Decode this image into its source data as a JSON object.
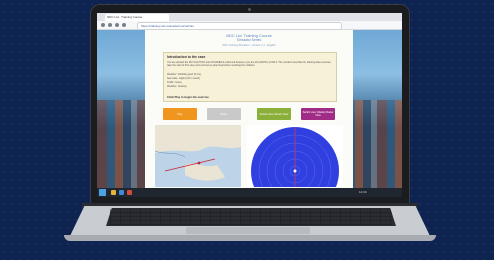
{
  "browser": {
    "tab_title": "NDC Ltd - Training Course",
    "url": "https://training.ndc.example/course/intro"
  },
  "page": {
    "title": "NDC Ltd. Training Course",
    "subtitle": "Simulator Series",
    "note": "NDC Training Simulator - Version 2.1 - English",
    "intro": {
      "heading": "Introduction to the case",
      "text": "You are aboard the MV CALYPSO and CHANNELS outbound between you are DA (DCPC) at 0013. The incident described in training data exercise; take the start of this case and commence planning before reaching the collision.",
      "lines": [
        "Weather: Visibility good (5 nm)",
        "Sea state: slight (2/3 m swell)",
        "Traffic: heavy",
        "Weather: clearing"
      ],
      "bold_line": "Click Play to begin the exercise"
    },
    "buttons": {
      "play": "Play",
      "reset": "Reset",
      "chart": "Switch view (Chart) View",
      "radar": "Switch view (Radar) Radar View"
    }
  },
  "colors": {
    "play": "#f0961e",
    "reset": "#c9c9c9",
    "chart": "#8bb03a",
    "radar": "#a12c87",
    "radar_fill": "#2f3fe0"
  },
  "taskbar": {
    "time": "12:34"
  }
}
